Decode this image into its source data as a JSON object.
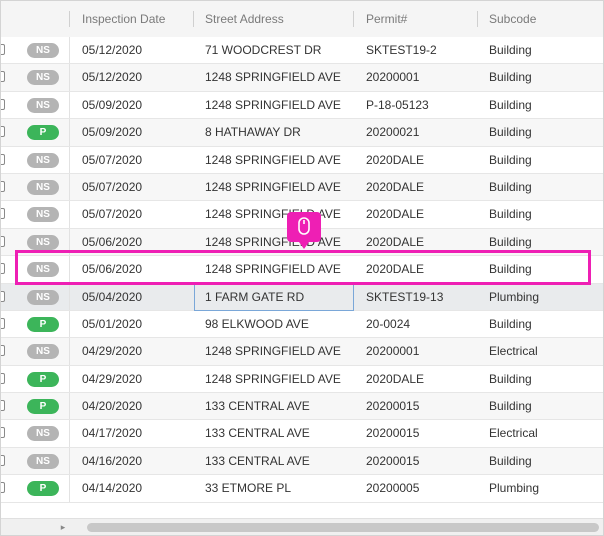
{
  "grid": {
    "columns": [
      "Inspection Date",
      "Street Address",
      "Permit#",
      "Subcode"
    ],
    "status_colors": {
      "NS": "#b4b4b4",
      "P": "#3cb55a"
    },
    "rows": [
      {
        "status": "NS",
        "date": "05/12/2020",
        "address": "71 WOODCREST DR",
        "permit": "SKTEST19-2",
        "subcode": "Building"
      },
      {
        "status": "NS",
        "date": "05/12/2020",
        "address": "1248 SPRINGFIELD AVE",
        "permit": "20200001",
        "subcode": "Building"
      },
      {
        "status": "NS",
        "date": "05/09/2020",
        "address": "1248 SPRINGFIELD AVE",
        "permit": "P-18-05123",
        "subcode": "Building"
      },
      {
        "status": "P",
        "date": "05/09/2020",
        "address": "8 HATHAWAY DR",
        "permit": "20200021",
        "subcode": "Building"
      },
      {
        "status": "NS",
        "date": "05/07/2020",
        "address": "1248 SPRINGFIELD AVE",
        "permit": "2020DALE",
        "subcode": "Building"
      },
      {
        "status": "NS",
        "date": "05/07/2020",
        "address": "1248 SPRINGFIELD AVE",
        "permit": "2020DALE",
        "subcode": "Building"
      },
      {
        "status": "NS",
        "date": "05/07/2020",
        "address": "1248 SPRINGFIELD AVE",
        "permit": "2020DALE",
        "subcode": "Building"
      },
      {
        "status": "NS",
        "date": "05/06/2020",
        "address": "1248 SPRINGFIELD AVE",
        "permit": "2020DALE",
        "subcode": "Building"
      },
      {
        "status": "NS",
        "date": "05/06/2020",
        "address": "1248 SPRINGFIELD AVE",
        "permit": "2020DALE",
        "subcode": "Building"
      },
      {
        "status": "NS",
        "date": "05/04/2020",
        "address": "1 FARM GATE RD",
        "permit": "SKTEST19-13",
        "subcode": "Plumbing"
      },
      {
        "status": "P",
        "date": "05/01/2020",
        "address": "98 ELKWOOD AVE",
        "permit": "20-0024",
        "subcode": "Building"
      },
      {
        "status": "NS",
        "date": "04/29/2020",
        "address": "1248 SPRINGFIELD AVE",
        "permit": "20200001",
        "subcode": "Electrical"
      },
      {
        "status": "P",
        "date": "04/29/2020",
        "address": "1248 SPRINGFIELD AVE",
        "permit": "2020DALE",
        "subcode": "Building"
      },
      {
        "status": "P",
        "date": "04/20/2020",
        "address": "133 CENTRAL AVE",
        "permit": "20200015",
        "subcode": "Building"
      },
      {
        "status": "NS",
        "date": "04/17/2020",
        "address": "133 CENTRAL AVE",
        "permit": "20200015",
        "subcode": "Electrical"
      },
      {
        "status": "NS",
        "date": "04/16/2020",
        "address": "133 CENTRAL AVE",
        "permit": "20200015",
        "subcode": "Building"
      },
      {
        "status": "P",
        "date": "04/14/2020",
        "address": "33 ETMORE PL",
        "permit": "20200005",
        "subcode": "Plumbing"
      }
    ]
  },
  "selection": {
    "selected_row": 9
  },
  "icons": {
    "cursor": "mouse-icon",
    "scroll_left": "scroll-left-arrow-icon"
  },
  "highlight_color": "#ee1fb4"
}
